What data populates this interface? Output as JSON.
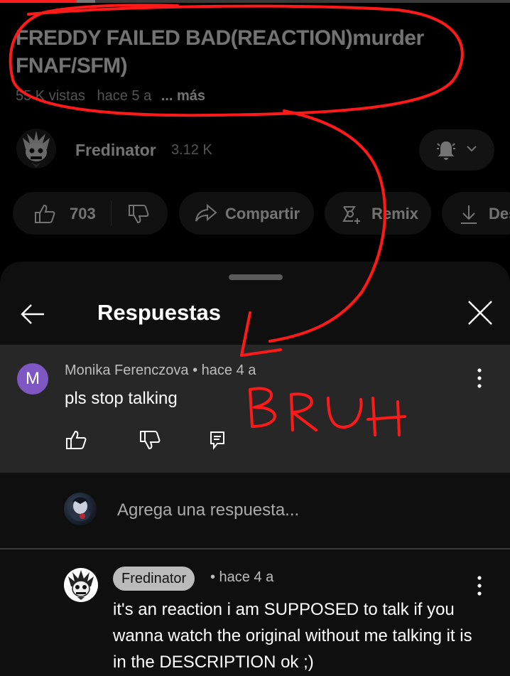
{
  "video": {
    "title": "FREDDY FAILED BAD(REACTION)murder FNAF/SFM)",
    "views": "55 K vistas",
    "age": "hace 5 a",
    "more": "... más",
    "channel": "Fredinator",
    "subscribers": "3.12 K",
    "likes": "703",
    "share_label": "Compartir",
    "remix_label": "Remix",
    "download_label": "Des",
    "progress_fraction": 0.15
  },
  "sheet": {
    "title": "Respuestas"
  },
  "parent_comment": {
    "avatar_letter": "M",
    "author_line": "Monika Ferenczova • hace 4 a",
    "text": "pls stop talking"
  },
  "reply_input": {
    "placeholder": "Agrega una respuesta..."
  },
  "reply": {
    "author": "Fredinator",
    "time": "• hace 4 a",
    "text": "it's an reaction i am SUPPOSED to talk if you wanna watch the original without me talking it is in the DESCRIPTION ok ;)"
  },
  "annotation": {
    "handwritten_text": "BRUH",
    "ink_color": "#ff1a1a"
  },
  "colors": {
    "accent_red": "#ff1d1d",
    "avatar_purple": "#7e57c2",
    "sheet_bg": "#0f0f0f",
    "highlight_bg": "#272727"
  }
}
